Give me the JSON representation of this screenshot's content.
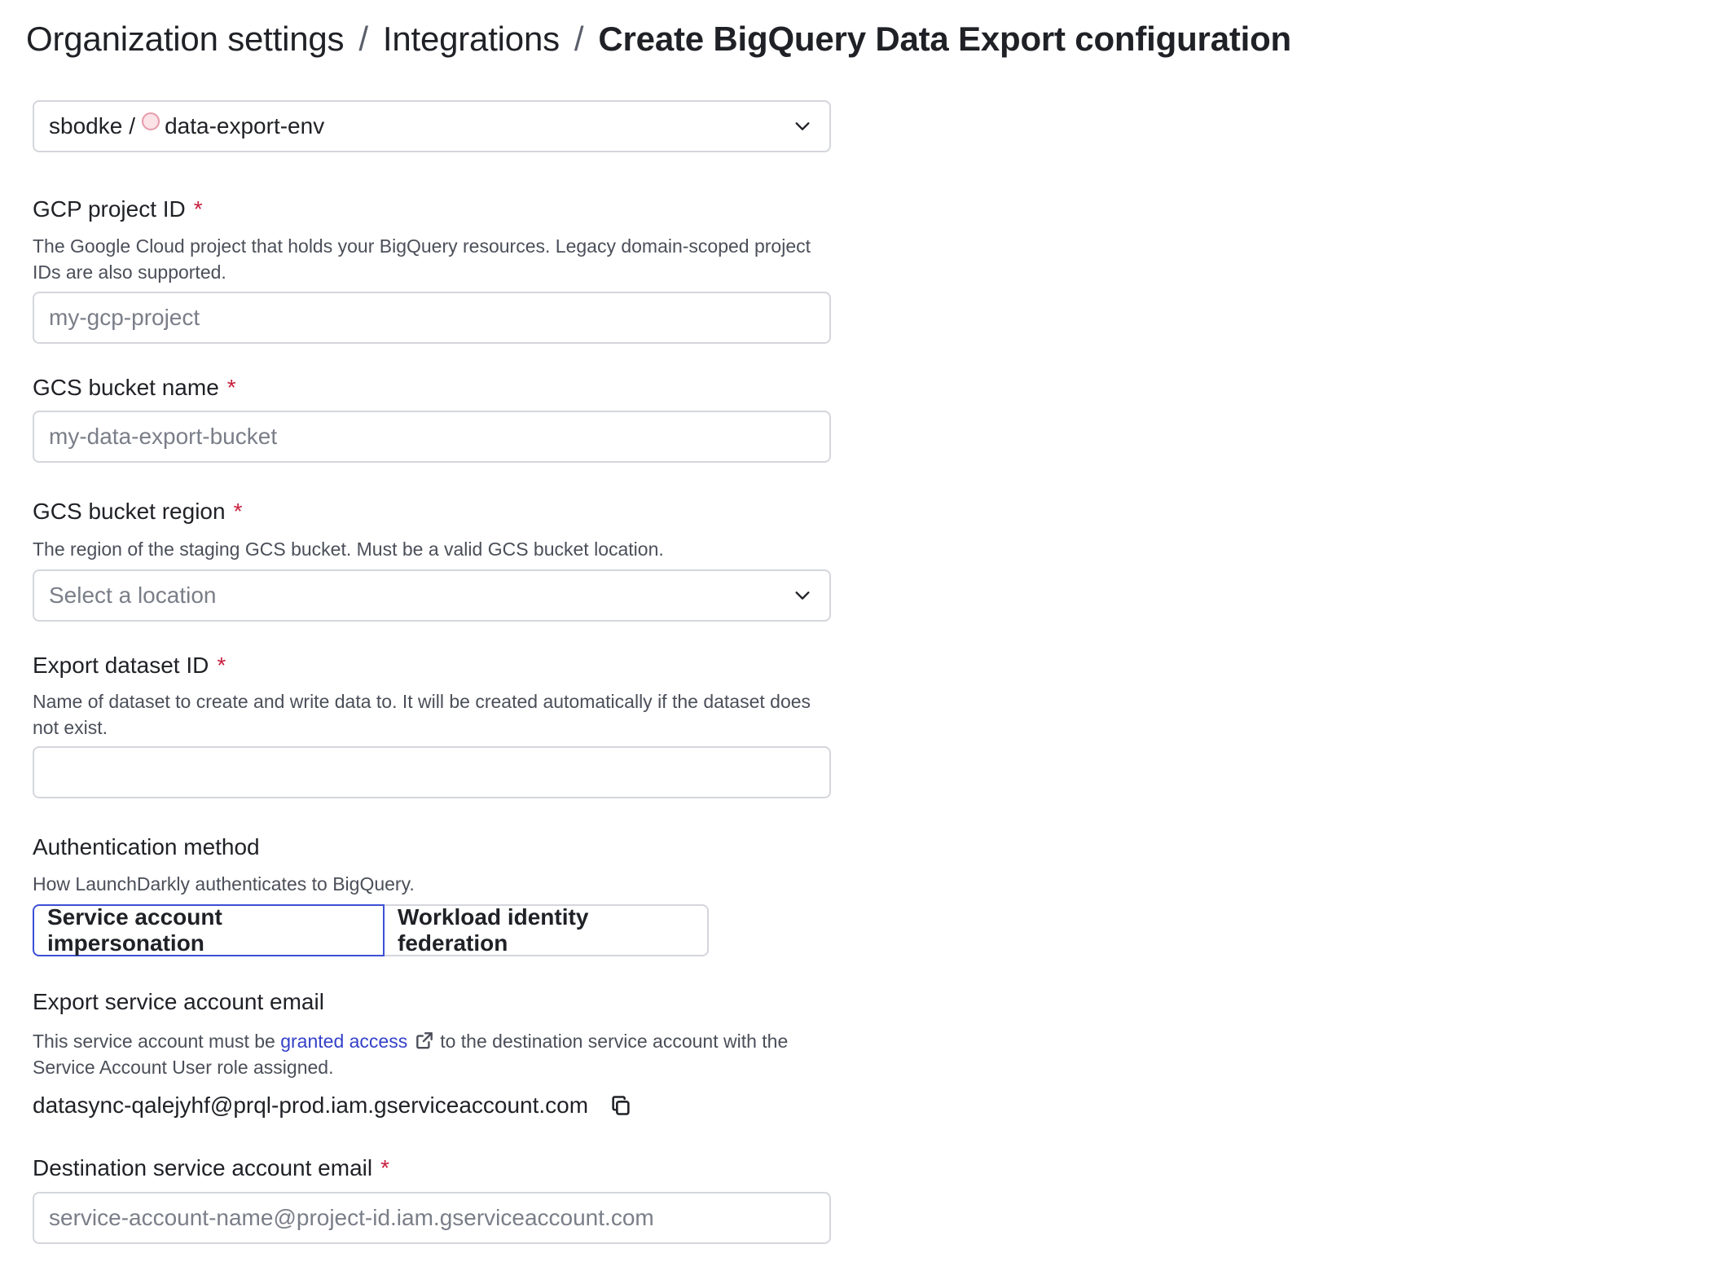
{
  "breadcrumb": {
    "items": [
      "Organization settings",
      "Integrations"
    ],
    "current": "Create BigQuery Data Export configuration",
    "separator": "/"
  },
  "project_env": {
    "project": "sbodke",
    "separator": "/",
    "environment": "data-export-env",
    "env_color": "#fbe3e8"
  },
  "fields": {
    "gcp_project": {
      "label": "GCP project ID",
      "required_mark": "*",
      "help": "The Google Cloud project that holds your BigQuery resources. Legacy domain-scoped project IDs are also supported.",
      "placeholder": "my-gcp-project"
    },
    "bucket_name": {
      "label": "GCS bucket name",
      "required_mark": "*",
      "placeholder": "my-data-export-bucket"
    },
    "bucket_region": {
      "label": "GCS bucket region",
      "required_mark": "*",
      "help": "The region of the staging GCS bucket. Must be a valid GCS bucket location.",
      "placeholder": "Select a location"
    },
    "dataset": {
      "label": "Export dataset ID",
      "required_mark": "*",
      "help": "Name of dataset to create and write data to. It will be created automatically if the dataset does not exist.",
      "value": ""
    },
    "auth": {
      "label": "Authentication method",
      "help": "How LaunchDarkly authenticates to BigQuery.",
      "options": [
        "Service account impersonation",
        "Workload identity federation"
      ],
      "selected": "Service account impersonation"
    },
    "export_account": {
      "label": "Export service account email",
      "help_before": "This service account must be",
      "help_link": "granted access",
      "help_after": "to the destination service account with the Service Account User role assigned.",
      "email": "datasync-qalejyhf@prql-prod.iam.gserviceaccount.com"
    },
    "destination_account": {
      "label": "Destination service account email",
      "required_mark": "*",
      "placeholder": "service-account-name@project-id.iam.gserviceaccount.com"
    }
  },
  "icons": {
    "chevron": "chevron-down-icon",
    "external": "external-link-icon",
    "copy": "copy-icon"
  },
  "colors": {
    "required": "#c8203f",
    "link": "#3441c8",
    "selected_border": "#3d4fd6"
  }
}
